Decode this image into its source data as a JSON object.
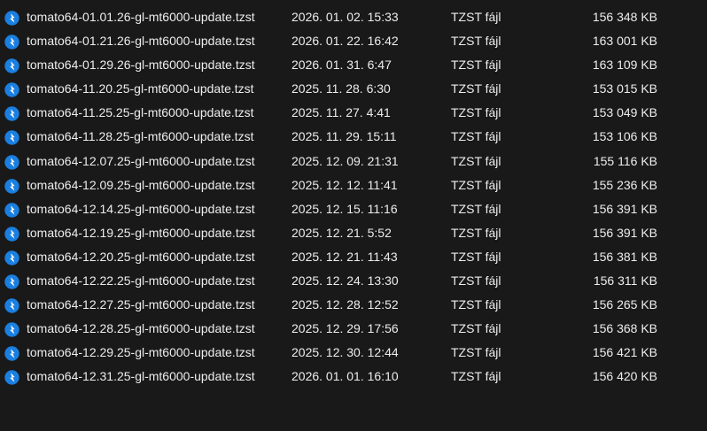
{
  "files": [
    {
      "name": "tomato64-01.01.26-gl-mt6000-update.tzst",
      "modified": "2026. 01. 02. 15:33",
      "type": "TZST fájl",
      "size": "156 348 KB",
      "icon": "file-type-icon"
    },
    {
      "name": "tomato64-01.21.26-gl-mt6000-update.tzst",
      "modified": "2026. 01. 22. 16:42",
      "type": "TZST fájl",
      "size": "163 001 KB",
      "icon": "file-type-icon"
    },
    {
      "name": "tomato64-01.29.26-gl-mt6000-update.tzst",
      "modified": "2026. 01. 31. 6:47",
      "type": "TZST fájl",
      "size": "163 109 KB",
      "icon": "file-type-icon"
    },
    {
      "name": "tomato64-11.20.25-gl-mt6000-update.tzst",
      "modified": "2025. 11. 28. 6:30",
      "type": "TZST fájl",
      "size": "153 015 KB",
      "icon": "file-type-icon"
    },
    {
      "name": "tomato64-11.25.25-gl-mt6000-update.tzst",
      "modified": "2025. 11. 27. 4:41",
      "type": "TZST fájl",
      "size": "153 049 KB",
      "icon": "file-type-icon"
    },
    {
      "name": "tomato64-11.28.25-gl-mt6000-update.tzst",
      "modified": "2025. 11. 29. 15:11",
      "type": "TZST fájl",
      "size": "153 106 KB",
      "icon": "file-type-icon"
    },
    {
      "name": "tomato64-12.07.25-gl-mt6000-update.tzst",
      "modified": "2025. 12. 09. 21:31",
      "type": "TZST fájl",
      "size": "155 116 KB",
      "icon": "file-type-icon"
    },
    {
      "name": "tomato64-12.09.25-gl-mt6000-update.tzst",
      "modified": "2025. 12. 12. 11:41",
      "type": "TZST fájl",
      "size": "155 236 KB",
      "icon": "file-type-icon"
    },
    {
      "name": "tomato64-12.14.25-gl-mt6000-update.tzst",
      "modified": "2025. 12. 15. 11:16",
      "type": "TZST fájl",
      "size": "156 391 KB",
      "icon": "file-type-icon"
    },
    {
      "name": "tomato64-12.19.25-gl-mt6000-update.tzst",
      "modified": "2025. 12. 21. 5:52",
      "type": "TZST fájl",
      "size": "156 391 KB",
      "icon": "file-type-icon"
    },
    {
      "name": "tomato64-12.20.25-gl-mt6000-update.tzst",
      "modified": "2025. 12. 21. 11:43",
      "type": "TZST fájl",
      "size": "156 381 KB",
      "icon": "file-type-icon"
    },
    {
      "name": "tomato64-12.22.25-gl-mt6000-update.tzst",
      "modified": "2025. 12. 24. 13:30",
      "type": "TZST fájl",
      "size": "156 311 KB",
      "icon": "file-type-icon"
    },
    {
      "name": "tomato64-12.27.25-gl-mt6000-update.tzst",
      "modified": "2025. 12. 28. 12:52",
      "type": "TZST fájl",
      "size": "156 265 KB",
      "icon": "file-type-icon"
    },
    {
      "name": "tomato64-12.28.25-gl-mt6000-update.tzst",
      "modified": "2025. 12. 29. 17:56",
      "type": "TZST fájl",
      "size": "156 368 KB",
      "icon": "file-type-icon"
    },
    {
      "name": "tomato64-12.29.25-gl-mt6000-update.tzst",
      "modified": "2025. 12. 30. 12:44",
      "type": "TZST fájl",
      "size": "156 421 KB",
      "icon": "file-type-icon"
    },
    {
      "name": "tomato64-12.31.25-gl-mt6000-update.tzst",
      "modified": "2026. 01. 01. 16:10",
      "type": "TZST fájl",
      "size": "156 420 KB",
      "icon": "file-type-icon"
    }
  ],
  "colors": {
    "background": "#191919",
    "text": "#ededed",
    "icon_fill": "#1a7fe0",
    "icon_glyph": "#ffffff"
  }
}
